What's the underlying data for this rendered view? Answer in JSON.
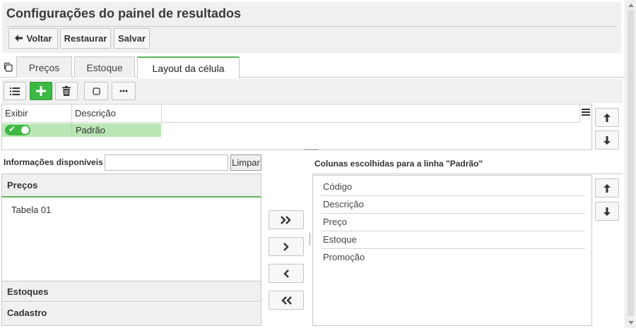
{
  "header": {
    "title": "Configurações do painel de resultados",
    "buttons": {
      "back": "Voltar",
      "restore": "Restaurar",
      "save": "Salvar"
    }
  },
  "tabs": [
    {
      "label": "Preços"
    },
    {
      "label": "Estoque"
    },
    {
      "label": "Layout da célula",
      "active": true
    }
  ],
  "toolbar": {
    "icons": [
      "list-icon",
      "plus-icon",
      "trash-icon",
      "square-icon",
      "more-icon"
    ]
  },
  "grid": {
    "columns": [
      "Exibir",
      "Descrição"
    ],
    "rows": [
      {
        "enabled": true,
        "description": "Padrão"
      }
    ]
  },
  "available": {
    "label": "Informações disponíveis",
    "filter_value": "",
    "clear_label": "Limpar",
    "sections": [
      {
        "title": "Preços",
        "items": [
          "Tabela 01"
        ],
        "expanded": true
      },
      {
        "title": "Estoques"
      },
      {
        "title": "Cadastro"
      }
    ]
  },
  "chosen": {
    "label": "Colunas escolhidas para a linha \"Padrão\"",
    "items": [
      "Código",
      "Descrição",
      "Preço",
      "Estoque",
      "Promoção"
    ]
  },
  "colors": {
    "accent_green": "#3db843",
    "row_selected": "#b9e6b4"
  }
}
